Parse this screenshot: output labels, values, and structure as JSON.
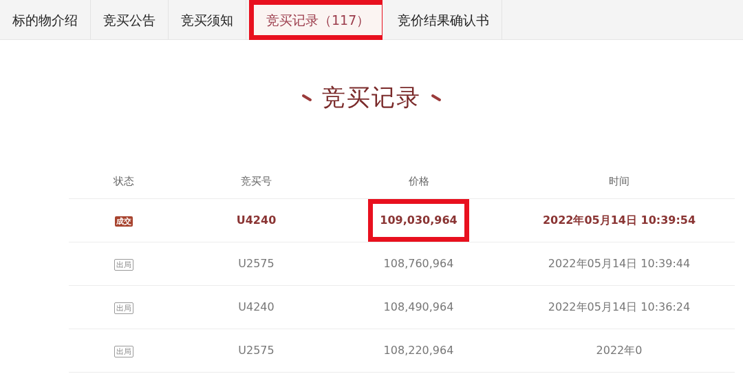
{
  "tabs": [
    {
      "label": "标的物介绍",
      "selected": false,
      "highlighted": false
    },
    {
      "label": "竞买公告",
      "selected": false,
      "highlighted": false
    },
    {
      "label": "竞买须知",
      "selected": false,
      "highlighted": false
    },
    {
      "label": "竞买记录（117）",
      "selected": true,
      "highlighted": true
    },
    {
      "label": "竞价结果确认书",
      "selected": false,
      "highlighted": false
    }
  ],
  "heading": "竞买记录",
  "table": {
    "columns": [
      "状态",
      "竞买号",
      "价格",
      "时间"
    ],
    "rows": [
      {
        "status": {
          "kind": "deal",
          "label": "成交"
        },
        "bidder": "U4240",
        "price": "109,030,964",
        "time": "2022年05月14日 10:39:54",
        "winning": true,
        "price_highlighted": true
      },
      {
        "status": {
          "kind": "out",
          "label": "出局"
        },
        "bidder": "U2575",
        "price": "108,760,964",
        "time": "2022年05月14日 10:39:44",
        "winning": false,
        "price_highlighted": false
      },
      {
        "status": {
          "kind": "out",
          "label": "出局"
        },
        "bidder": "U4240",
        "price": "108,490,964",
        "time": "2022年05月14日 10:36:24",
        "winning": false,
        "price_highlighted": false
      },
      {
        "status": {
          "kind": "out",
          "label": "出局"
        },
        "bidder": "U2575",
        "price": "108,220,964",
        "time": "2022年0",
        "winning": false,
        "price_highlighted": false
      }
    ]
  }
}
